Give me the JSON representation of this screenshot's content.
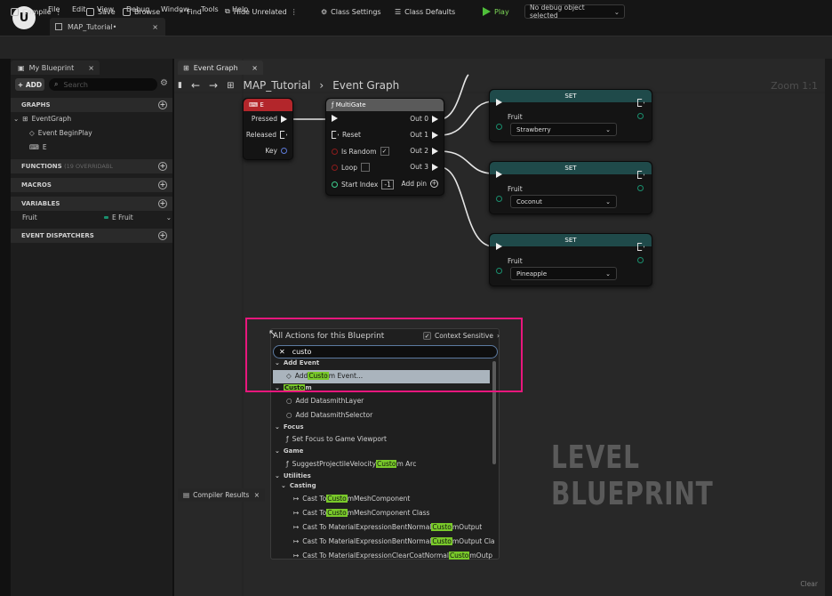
{
  "menu": {
    "logo": "U",
    "items": [
      "File",
      "Edit",
      "View",
      "Debug",
      "Window",
      "Tools",
      "Help"
    ]
  },
  "doc_tab": {
    "label": "MAP_Tutorial•",
    "close": "×"
  },
  "toolbar": {
    "compile": "Compile",
    "save": "Save",
    "browse": "Browse",
    "find": "Find",
    "hide_unrelated": "Hide Unrelated",
    "class_settings": "Class Settings",
    "class_defaults": "Class Defaults",
    "play": "Play",
    "debug_object": "No debug object selected"
  },
  "left_panel": {
    "tab": "My Blueprint",
    "close": "×",
    "add": "+ ADD",
    "search_placeholder": "Search",
    "graphs": "GRAPHS",
    "event_graph": "EventGraph",
    "event_begin_play": "Event BeginPlay",
    "e_event": "E",
    "functions": "FUNCTIONS",
    "functions_note": "(19 OVERRIDABL",
    "macros": "MACROS",
    "variables": "VARIABLES",
    "var_name": "Fruit",
    "var_type": "E Fruit",
    "dispatchers": "EVENT DISPATCHERS"
  },
  "graph": {
    "tab": "Event Graph",
    "close": "×",
    "breadcrumb": [
      "MAP_Tutorial",
      "Event Graph"
    ],
    "zoom": "Zoom 1:1",
    "watermark": "LEVEL BLUEPRINT",
    "clear": "Clear"
  },
  "e_node": {
    "title": "E",
    "pins": [
      "Pressed",
      "Released",
      "Key"
    ]
  },
  "multigate": {
    "title": "MultiGate",
    "inputs": [
      "Reset",
      "Is Random",
      "Loop",
      "Start Index"
    ],
    "start_index": "-1",
    "outputs": [
      "Out 0",
      "Out 1",
      "Out 2",
      "Out 3"
    ],
    "add_pin": "Add pin"
  },
  "set_nodes": [
    {
      "title": "SET",
      "var": "Fruit",
      "value": "Strawberry"
    },
    {
      "title": "SET",
      "var": "Fruit",
      "value": "Coconut"
    },
    {
      "title": "SET",
      "var": "Fruit",
      "value": "Pineapple"
    }
  ],
  "popup": {
    "title": "All Actions for this Blueprint",
    "context": "Context Sensitive",
    "search": "custo",
    "rows": [
      {
        "kind": "cat",
        "pre": "Add Event",
        "hl": "",
        "post": ""
      },
      {
        "kind": "item",
        "pre": "Add ",
        "hl": "Custo",
        "post": "m Event..."
      },
      {
        "kind": "cat",
        "pre": "",
        "hl": "Custo",
        "post": "m"
      },
      {
        "kind": "item",
        "pre": "Add DatasmithLayer",
        "hl": "",
        "post": ""
      },
      {
        "kind": "item",
        "pre": "Add DatasmithSelector",
        "hl": "",
        "post": ""
      },
      {
        "kind": "cat",
        "pre": "Focus",
        "hl": "",
        "post": ""
      },
      {
        "kind": "item",
        "pre": "Set Focus to Game Viewport",
        "hl": "",
        "post": ""
      },
      {
        "kind": "cat",
        "pre": "Game",
        "hl": "",
        "post": ""
      },
      {
        "kind": "item",
        "pre": "SuggestProjectileVelocity ",
        "hl": "Custo",
        "post": "m Arc"
      },
      {
        "kind": "cat",
        "pre": "Utilities",
        "hl": "",
        "post": ""
      },
      {
        "kind": "cat",
        "pre": "Casting",
        "hl": "",
        "post": ""
      },
      {
        "kind": "item",
        "pre": "Cast To ",
        "hl": "Custo",
        "post": "mMeshComponent"
      },
      {
        "kind": "item",
        "pre": "Cast To ",
        "hl": "Custo",
        "post": "mMeshComponent Class"
      },
      {
        "kind": "item",
        "pre": "Cast To MaterialExpressionBentNormal",
        "hl": "Custo",
        "post": "mOutput"
      },
      {
        "kind": "item",
        "pre": "Cast To MaterialExpressionBentNormal",
        "hl": "Custo",
        "post": "mOutput Cla"
      },
      {
        "kind": "item",
        "pre": "Cast To MaterialExpressionClearCoatNormal",
        "hl": "Custo",
        "post": "mOutp"
      }
    ]
  },
  "compiler": {
    "tab": "Compiler Results",
    "close": "×"
  },
  "colors": {
    "accent_highlight": "#e8177d",
    "search_match": "#79c92a",
    "play": "#4fbf3a",
    "e_header": "#b3262b",
    "set_header": "#1f4a4a"
  }
}
